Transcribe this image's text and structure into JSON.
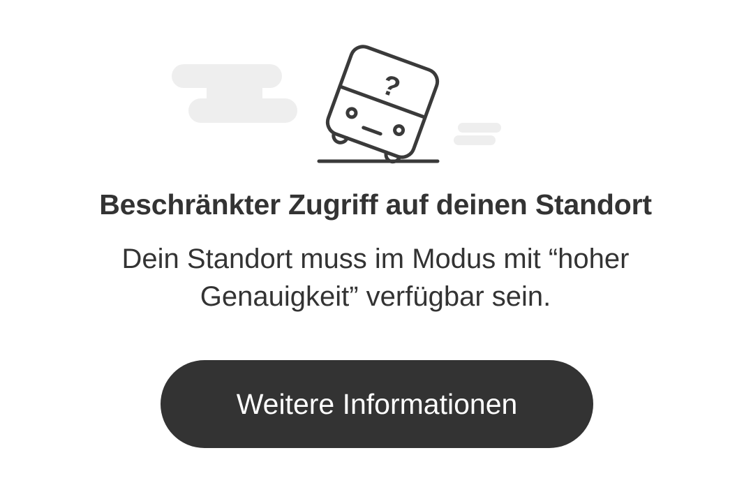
{
  "illustration": {
    "icon": "tilted-bus-question-icon",
    "glyph": "?",
    "stroke_color": "#3a3a3a",
    "cloud_color": "#eeeeee"
  },
  "message": {
    "title": "Beschränkter Zugriff auf deinen Standort",
    "description": "Dein Standort muss im Modus mit “hoher Genauigkeit” verfügbar sein."
  },
  "action": {
    "label": "Weitere Informationen",
    "background": "#333333",
    "text_color": "#ffffff"
  }
}
